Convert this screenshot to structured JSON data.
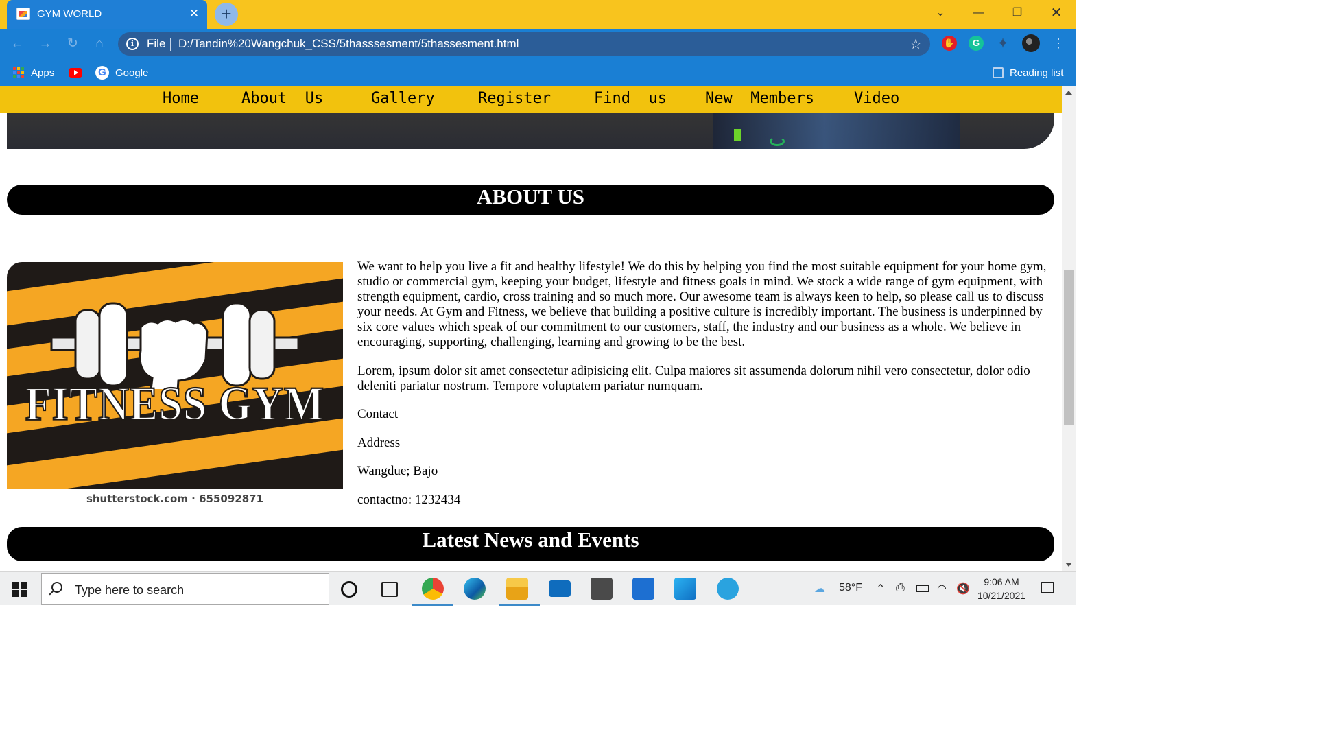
{
  "browser": {
    "tab_title": "GYM WORLD",
    "url_scheme": "File",
    "url": "D:/Tandin%20Wangchuk_CSS/5thasssesment/5thassesment.html",
    "bookmarks": [
      "Apps",
      "Google"
    ],
    "reading_list": "Reading list",
    "extensions": [
      "adblock-icon",
      "grammarly-icon",
      "puzzle-icon",
      "profile-avatar"
    ]
  },
  "nav": {
    "items": [
      "Home",
      "About  Us",
      "Gallery",
      "Register",
      "Find  us",
      "New  Members",
      "Video"
    ]
  },
  "about": {
    "heading": "ABOUT US",
    "logo_text": "FITNESS GYM",
    "logo_caption": "shutterstock.com · 655092871",
    "paragraph1": "We want to help you live a fit and healthy lifestyle! We do this by helping you find the most suitable equipment for your home gym, studio or commercial gym, keeping your budget, lifestyle and fitness goals in mind. We stock a wide range of gym equipment, with strength equipment, cardio, cross training and so much more. Our awesome team is always keen to help, so please call us to discuss your needs. At Gym and Fitness, we believe that building a positive culture is incredibly important. The business is underpinned by six core values which speak of our commitment to our customers, staff, the industry and our business as a whole. We believe in encouraging, supporting, challenging, learning and growing to be the best.",
    "paragraph2": "Lorem, ipsum dolor sit amet consectetur adipisicing elit. Culpa maiores sit assumenda dolorum nihil vero consectetur, dolor odio deleniti pariatur nostrum. Tempore voluptatem pariatur numquam.",
    "contact_label": "Contact",
    "address_label": "Address",
    "address": "Wangdue; Bajo",
    "contact_no": "contactno: 1232434"
  },
  "news": {
    "heading": "Latest News and Events"
  },
  "taskbar": {
    "search_placeholder": "Type here to search",
    "weather": "58°F",
    "time": "9:06 AM",
    "date": "10/21/2021",
    "apps": [
      "cortana-icon",
      "task-view-icon",
      "chrome-icon",
      "edge-icon",
      "file-explorer-icon",
      "mail-icon",
      "sublime-text-icon",
      "bracket-app-icon",
      "vscode-icon",
      "telegram-icon"
    ]
  },
  "colors": {
    "titlebar": "#f8c41e",
    "toolbar": "#1a7fd4",
    "navbar": "#f2c20d",
    "heading_bar": "#000000",
    "logo_orange": "#f5a623"
  }
}
